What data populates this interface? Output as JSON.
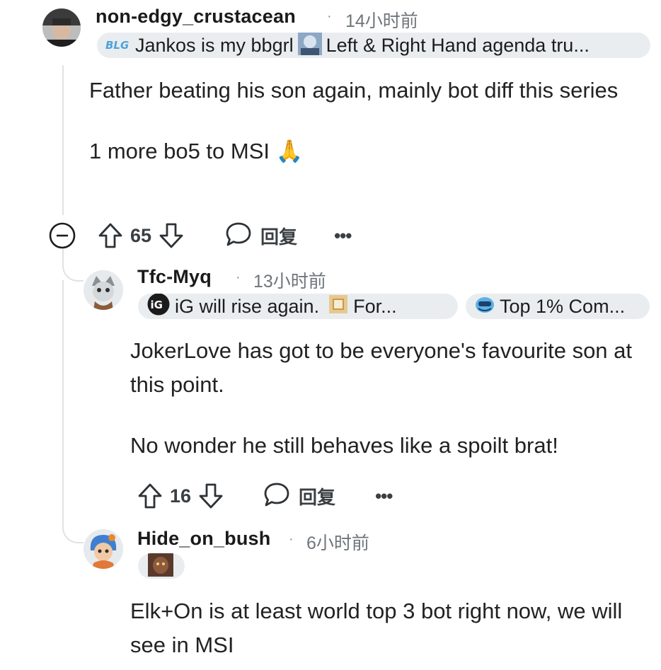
{
  "comments": [
    {
      "username": "non-edgy_crustacean",
      "separator": "·",
      "time": "14小时前",
      "flair_text": "Jankos is my bbgrl",
      "flair_text2": "Left & Right Hand agenda tru...",
      "body": [
        "Father beating his son again, mainly bot diff this series",
        "1 more bo5 to MSI 🙏"
      ],
      "score": "65",
      "reply_label": "回复",
      "more_label": "•••"
    },
    {
      "username": "Tfc-Myq",
      "separator": "·",
      "time": "13小时前",
      "flair_text": "iG will rise again.",
      "flair_text_b": "For...",
      "flair2_text": "Top 1% Com...",
      "body": [
        "JokerLove has got to be everyone's favourite son at this point.",
        "No wonder he still behaves like a spoilt brat!"
      ],
      "score": "16",
      "reply_label": "回复",
      "more_label": "•••"
    },
    {
      "username": "Hide_on_bush",
      "separator": "·",
      "time": "6小时前",
      "body": [
        "Elk+On is at least world top 3 bot right now, we will see in MSI"
      ]
    }
  ],
  "icons": {
    "collapse": "collapse-minus-icon",
    "upvote": "upvote-arrow-icon",
    "downvote": "downvote-arrow-icon",
    "reply": "speech-bubble-icon"
  }
}
